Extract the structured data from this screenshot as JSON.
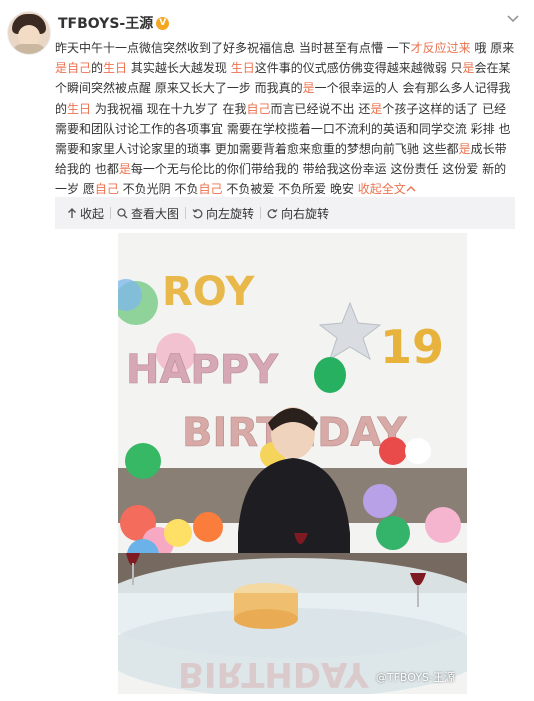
{
  "post": {
    "username": "TFBOYS-王源",
    "badge": "V",
    "more_icon": "chevron-down-icon",
    "text_segments": [
      {
        "t": "昨天中午十一点微信突然收到了好多祝福信息 当时甚至有点懵 一下",
        "hl": false
      },
      {
        "t": "才反应过来",
        "hl": true
      },
      {
        "t": " 哦 原来",
        "hl": false
      },
      {
        "t": "是自己",
        "hl": true
      },
      {
        "t": "的",
        "hl": false
      },
      {
        "t": "生日",
        "hl": true
      },
      {
        "t": " 其实越长大越发现 ",
        "hl": false
      },
      {
        "t": "生日",
        "hl": true
      },
      {
        "t": "这件事的仪式感仿佛变得越来越微弱 只",
        "hl": false
      },
      {
        "t": "是",
        "hl": true
      },
      {
        "t": "会在某个瞬间突然被点醒 原来又长大了一步 而我真的",
        "hl": false
      },
      {
        "t": "是",
        "hl": true
      },
      {
        "t": "一个很幸运的人 会有那么多人记得我的",
        "hl": false
      },
      {
        "t": "生日",
        "hl": true
      },
      {
        "t": " 为我祝福 现在十九岁了 在我",
        "hl": false
      },
      {
        "t": "自己",
        "hl": true
      },
      {
        "t": "而言已经说不出 还",
        "hl": false
      },
      {
        "t": "是",
        "hl": true
      },
      {
        "t": "个孩子这样的话了 已经需要和团队讨论工作的各项事宜 需要在学校揽着一口不流利的英语和同学交流 彩排 也需要和家里人讨论家里的琐事 更加需要背着愈来愈重的梦想向前飞驰 这些都",
        "hl": false
      },
      {
        "t": "是",
        "hl": true
      },
      {
        "t": "成长带给我的 也都",
        "hl": false
      },
      {
        "t": "是",
        "hl": true
      },
      {
        "t": "每一个无与伦比的你们带给我的 带给我这份幸运 这份责任 这份爱 新的一岁 愿",
        "hl": false
      },
      {
        "t": "自己",
        "hl": true
      },
      {
        "t": " 不负光阴 不负",
        "hl": false
      },
      {
        "t": "自己",
        "hl": true
      },
      {
        "t": " 不负被爱 不负所爱 晚安 ",
        "hl": false
      }
    ],
    "collapse_link": "收起全文",
    "collapse_icon": "chevron-up-icon"
  },
  "toolbar": {
    "collapse": "收起",
    "view_large": "查看大图",
    "rotate_left": "向左旋转",
    "rotate_right": "向右旋转"
  },
  "photo": {
    "balloon_letters_top": "ROY",
    "balloon_number": "19",
    "banner_happy": "HAPPY",
    "banner_birthday": "BIRTHDAY",
    "watermark": "@TFBOYS-王源"
  }
}
